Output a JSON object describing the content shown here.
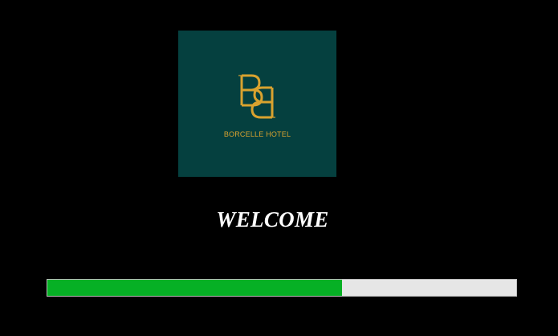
{
  "logo": {
    "hotel_name": "BORCELLE HOTEL",
    "monogram": "BB",
    "background_color": "#05403f",
    "accent_color": "#d9a22f"
  },
  "welcome_text": "WELCOME",
  "progress": {
    "fraction": 0.628,
    "fill_color": "#06b025",
    "track_color": "#e6e6e6"
  }
}
